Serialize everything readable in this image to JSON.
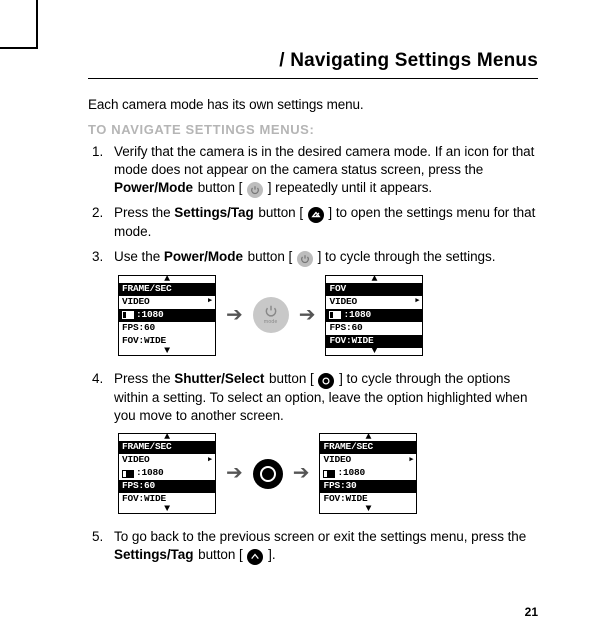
{
  "header": {
    "title": "/ Navigating Settings Menus"
  },
  "intro": "Each camera mode has its own settings menu.",
  "subhead": "TO NAVIGATE SETTINGS MENUS:",
  "steps": {
    "s1": {
      "num": "1.",
      "t1": "Verify that the camera is in the desired camera mode. If an icon for that mode does not appear on the camera status screen, press the ",
      "bold1": "Power/Mode",
      "t2": " button [ ",
      "t3": " ] repeatedly until it appears."
    },
    "s2": {
      "num": "2.",
      "t1": "Press the ",
      "bold1": "Settings/Tag",
      "t2": " button [ ",
      "t3": " ] to open the settings menu for that mode."
    },
    "s3": {
      "num": "3.",
      "t1": "Use the ",
      "bold1": "Power/Mode",
      "t2": " button [ ",
      "t3": " ] to cycle through the settings."
    },
    "s4": {
      "num": "4.",
      "t1": "Press the ",
      "bold1": "Shutter/Select",
      "t2": " button [ ",
      "t3": " ] to cycle through the options within a setting. To select an option, leave the option highlighted when you move to another screen."
    },
    "s5": {
      "num": "5.",
      "t1": "To go back to the previous screen or exit the settings menu, press the ",
      "bold1": "Settings/Tag",
      "t2": " button [ ",
      "t3": " ]."
    }
  },
  "lcd": {
    "a": {
      "header": "FRAME/SEC",
      "r1": "VIDEO",
      "r2v": "1080",
      "r2hl": true,
      "r3k": "FPS:",
      "r3v": "60",
      "r4k": "FOV:",
      "r4v": "WIDE"
    },
    "b": {
      "header": "FOV",
      "r1": "VIDEO",
      "r2v": "1080",
      "r2hl": true,
      "r3k": "FPS:",
      "r3v": "60",
      "r4k": "FOV:",
      "r4v": "WIDE",
      "r4hl": true
    },
    "c": {
      "header": "FRAME/SEC",
      "r1": "VIDEO",
      "r2v": "1080",
      "r3k": "FPS:",
      "r3v": "60",
      "r3hl": true,
      "r4k": "FOV:",
      "r4v": "WIDE"
    },
    "d": {
      "header": "FRAME/SEC",
      "r1": "VIDEO",
      "r2v": "1080",
      "r3k": "FPS:",
      "r3v": "30",
      "r3hl": true,
      "r4k": "FOV:",
      "r4v": "WIDE"
    }
  },
  "mode_label": "mode",
  "pagenum": "21"
}
